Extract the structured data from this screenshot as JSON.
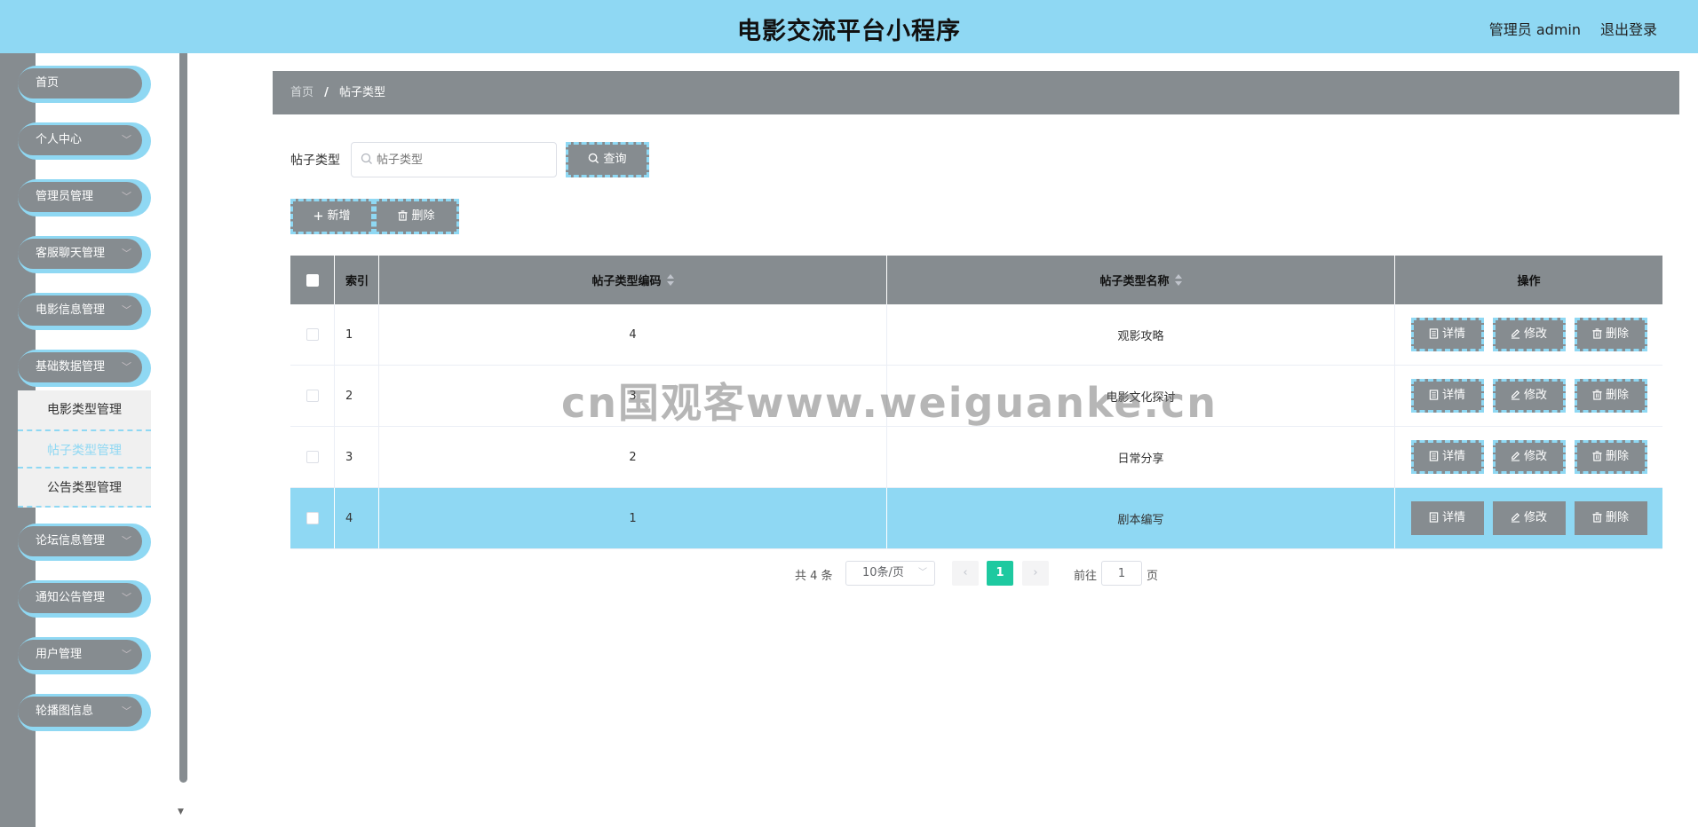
{
  "header": {
    "title": "电影交流平台小程序",
    "user": "管理员 admin",
    "logout": "退出登录"
  },
  "sidebar": {
    "items": [
      {
        "label": "首页",
        "has_caret": false
      },
      {
        "label": "个人中心",
        "has_caret": true
      },
      {
        "label": "管理员管理",
        "has_caret": true
      },
      {
        "label": "客服聊天管理",
        "has_caret": true
      },
      {
        "label": "电影信息管理",
        "has_caret": true
      },
      {
        "label": "基础数据管理",
        "has_caret": true
      },
      {
        "label": "论坛信息管理",
        "has_caret": true
      },
      {
        "label": "通知公告管理",
        "has_caret": true
      },
      {
        "label": "用户管理",
        "has_caret": true
      },
      {
        "label": "轮播图信息",
        "has_caret": true
      }
    ],
    "submenu": [
      "电影类型管理",
      "帖子类型管理",
      "公告类型管理"
    ],
    "active_submenu": "帖子类型管理"
  },
  "breadcrumb": {
    "home": "首页",
    "separator": "/",
    "current": "帖子类型"
  },
  "search": {
    "label": "帖子类型",
    "placeholder": "帖子类型",
    "value": "",
    "button": "查询"
  },
  "actions": {
    "add": "新增",
    "delete": "删除"
  },
  "table": {
    "columns": [
      "索引",
      "帖子类型编码",
      "帖子类型名称",
      "操作"
    ],
    "rows": [
      {
        "index": "1",
        "code": "4",
        "name": "观影攻略",
        "highlighted": false
      },
      {
        "index": "2",
        "code": "3",
        "name": "电影文化探讨",
        "highlighted": false
      },
      {
        "index": "3",
        "code": "2",
        "name": "日常分享",
        "highlighted": false
      },
      {
        "index": "4",
        "code": "1",
        "name": "剧本编写",
        "highlighted": true
      }
    ],
    "row_actions": {
      "detail": "详情",
      "edit": "修改",
      "delete": "删除"
    }
  },
  "pagination": {
    "total": "共 4 条",
    "page_size": "10条/页",
    "current_page": "1",
    "goto_label": "前往",
    "goto_value": "1",
    "page_suffix": "页"
  },
  "watermark": "cn国观客www.weiguanke.cn",
  "colors": {
    "accent": "#8fd8f3",
    "gray": "#868c90",
    "page_active": "#1ec9a0"
  }
}
